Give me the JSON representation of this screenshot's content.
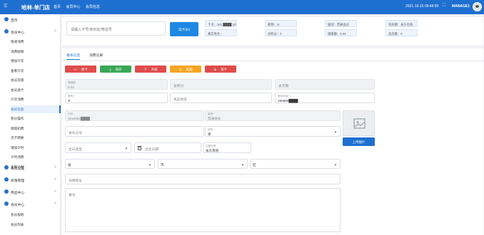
{
  "header": {
    "app_title": "哈林-单门店",
    "breadcrumbs": [
      "首页",
      "会员中心",
      "会员信息"
    ],
    "datetime": "2021-10-15 09:48:50",
    "username": "MANAGE1"
  },
  "sidebar": {
    "home": "首页",
    "member_center": "会员中心",
    "member_items": [
      "快速消费",
      "消费收银",
      "增加计次",
      "查看计次",
      "会员充值",
      "会员退卡",
      "计次消费",
      "会员信息",
      "积分操作",
      "储值扣费",
      "次卡转换",
      "增加计时",
      "计时消费",
      "查看计时"
    ],
    "active_member_item": "会员信息",
    "system": "系统设置",
    "permission": "权限管理",
    "goods": "商品中心",
    "member_center_2": "会员中心",
    "member_center_2_items": [
      "会员规则",
      "会员列表"
    ]
  },
  "top_panel": {
    "search_placeholder": "请输入卡号/身份证/电话号",
    "read_card_button": "读卡(D)",
    "info": {
      "card_no": "卡号：101 ████ 1015",
      "nickname": "昵称：zt",
      "level": "级别：普通会员",
      "valid_until": "有效期：永久有效",
      "real_name": "真实姓名：",
      "points": "总积分：0",
      "balance": "储值额：0.04",
      "count": "总次数：0"
    }
  },
  "tabs": [
    "基本信息",
    "消费记录"
  ],
  "actions": [
    {
      "icon": "card",
      "label": "换卡",
      "color": "#e04b4b"
    },
    {
      "icon": "save",
      "label": "保存",
      "color": "#3aa757"
    },
    {
      "icon": "upgrade",
      "label": "升级",
      "color": "#e04b4b"
    },
    {
      "icon": "extend",
      "label": "延期",
      "color": "#f5a623"
    },
    {
      "icon": "lock",
      "label": "锁卡",
      "color": "#e04b4b"
    }
  ],
  "form": {
    "balance_label": "储值额",
    "balance_value": "0.04",
    "points_placeholder": "总积分",
    "count_placeholder": "总次数",
    "nickname_label": "昵称 *",
    "nickname_value": "zt",
    "realname_placeholder": "真实姓名",
    "phone_label": "联系电话 *",
    "phone_value": "185860████",
    "cardno_label": "卡号",
    "cardno_value": "1015352████",
    "level_label": "级别 *",
    "level_value": "普通会员",
    "idcard_placeholder": "身份证号",
    "gender_label": "性别",
    "gender_value": "男",
    "birthday_type_placeholder": "生日类型",
    "birthday_placeholder": "出生日期",
    "valid_label": "过期日期",
    "valid_value": "永久有效",
    "province": "省",
    "city": "市",
    "district": "区",
    "address_placeholder": "详细地址",
    "remark_placeholder": "备注",
    "upload_button": "上传图片"
  }
}
